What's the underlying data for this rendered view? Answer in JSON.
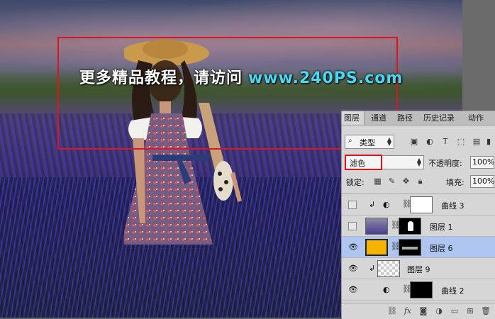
{
  "watermark": {
    "text": "更多精品教程，请访问",
    "url": "www.240PS.com"
  },
  "panel": {
    "tabs": [
      "图层",
      "通道",
      "路径",
      "历史记录",
      "动作"
    ],
    "active_tab": "图层",
    "filter": {
      "label": "类型"
    },
    "filter_icons": [
      "image-filter-icon",
      "adjustment-filter-icon",
      "text-filter-icon",
      "shape-filter-icon",
      "smart-object-filter-icon"
    ],
    "blend_mode": "滤色",
    "opacity_label": "不透明度:",
    "opacity_value": "100%",
    "lock_label": "锁定:",
    "fill_label": "填充:",
    "fill_value": "100%",
    "layers": [
      {
        "name": "曲线 3",
        "visible": false,
        "clipped": true,
        "kind": "curves-adjustment"
      },
      {
        "name": "图层 1",
        "visible": false,
        "clipped": false,
        "kind": "photo-with-mask"
      },
      {
        "name": "图层 6",
        "visible": true,
        "clipped": false,
        "kind": "orange-fill-with-mask",
        "selected": true,
        "color": "#f5b400"
      },
      {
        "name": "图层 9",
        "visible": true,
        "clipped": true,
        "kind": "transparent"
      },
      {
        "name": "曲线 2",
        "visible": true,
        "clipped": false,
        "kind": "curves-adjustment"
      }
    ],
    "footer_icons": [
      "link-icon",
      "fx-icon",
      "mask-icon",
      "adjustment-icon",
      "group-icon",
      "new-layer-icon",
      "trash-icon"
    ],
    "footer_fx": "fx"
  },
  "colors": {
    "highlight_red": "#e0141e",
    "url_cyan": "#48d9f5",
    "selected_layer_bg": "#aec6ef"
  }
}
